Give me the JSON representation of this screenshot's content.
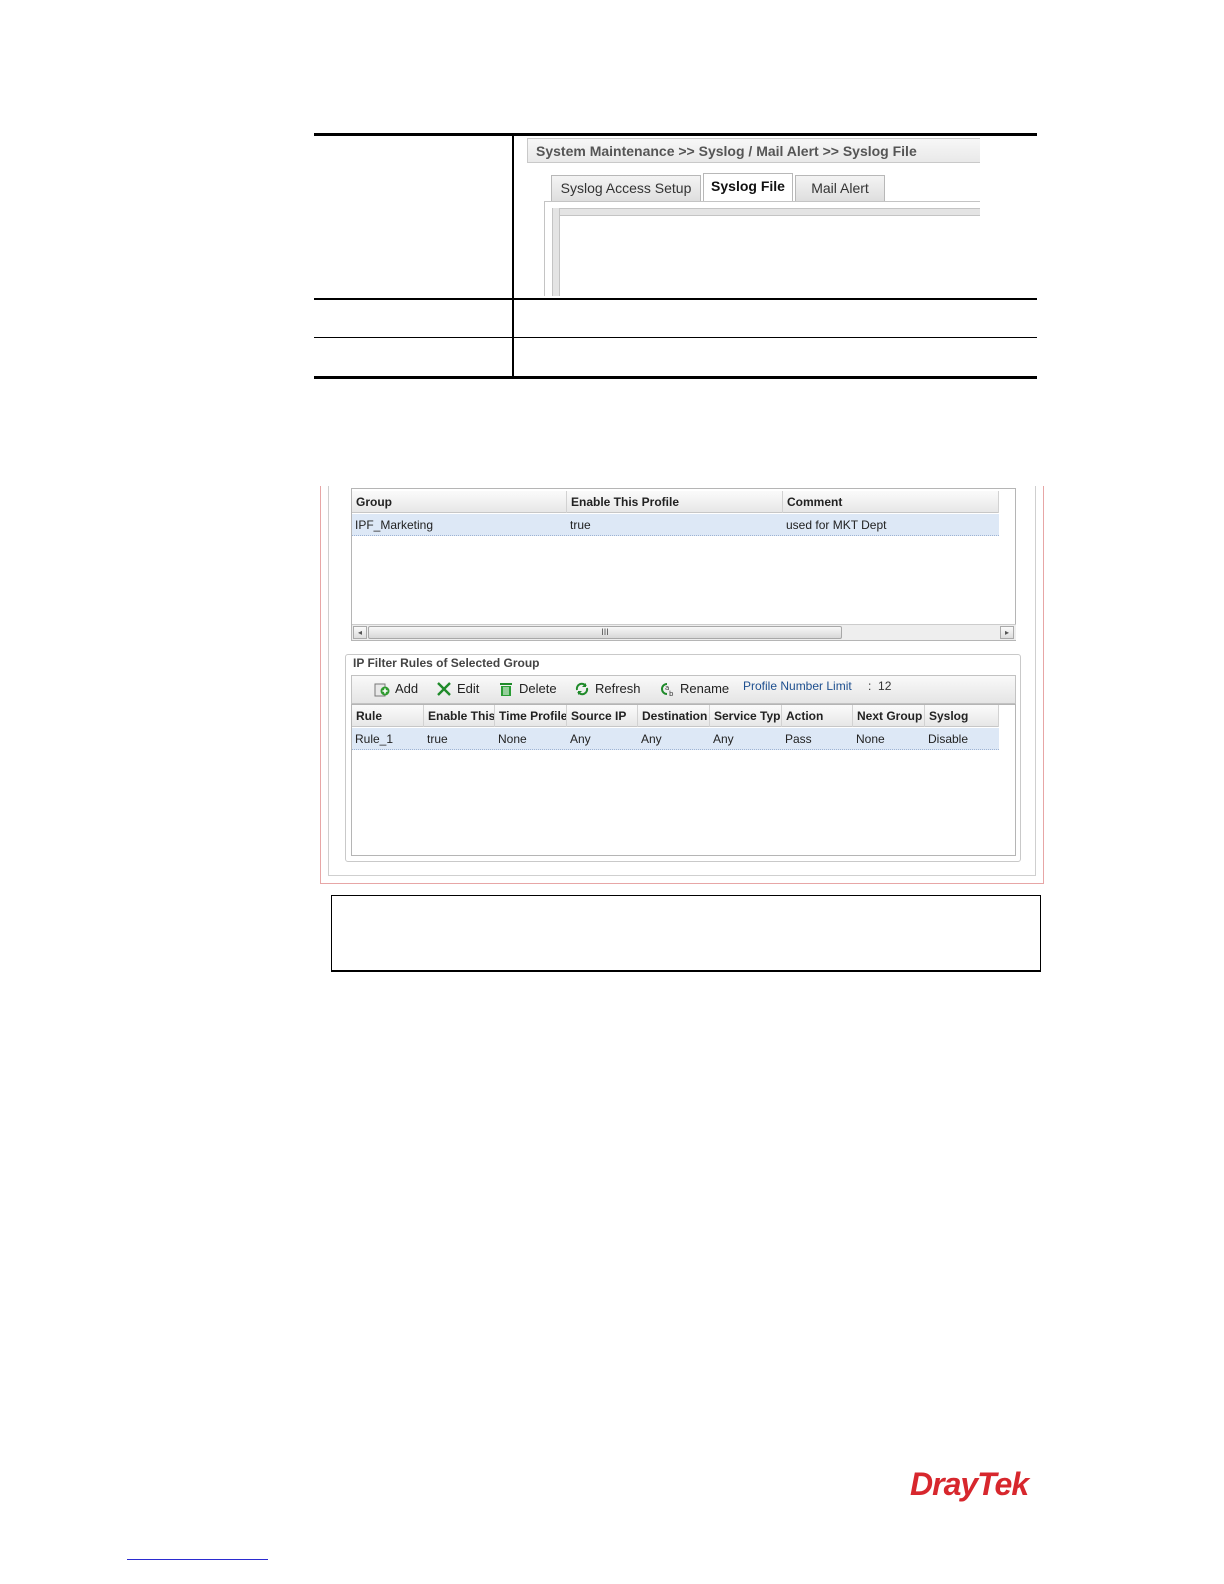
{
  "syslog_screenshot": {
    "breadcrumb": "System Maintenance >> Syslog / Mail Alert >> Syslog File",
    "tabs": [
      {
        "label": "Syslog Access Setup",
        "active": false
      },
      {
        "label": "Syslog File",
        "active": true
      },
      {
        "label": "Mail Alert",
        "active": false
      }
    ]
  },
  "group_grid": {
    "columns": [
      "Group",
      "Enable This Profile",
      "Comment"
    ],
    "rows": [
      {
        "group": "IPF_Marketing",
        "enable": "true",
        "comment": "used for MKT Dept"
      }
    ],
    "scroll_thumb_label": "III"
  },
  "rules_panel": {
    "legend": "IP Filter Rules of Selected Group",
    "toolbar": {
      "add": "Add",
      "edit": "Edit",
      "delete": "Delete",
      "refresh": "Refresh",
      "rename": "Rename"
    },
    "limit_label": "Profile Number Limit",
    "limit_sep": ":",
    "limit_value": "12",
    "columns": [
      "Rule",
      "Enable This",
      "Time Profile",
      "Source IP",
      "Destination I",
      "Service Type",
      "Action",
      "Next Group",
      "Syslog"
    ],
    "rows": [
      {
        "rule": "Rule_1",
        "enable": "true",
        "time_profile": "None",
        "source_ip": "Any",
        "destination_ip": "Any",
        "service_type": "Any",
        "action": "Pass",
        "next_group": "None",
        "syslog": "Disable"
      }
    ]
  },
  "brand": {
    "logo_text": "DrayTek",
    "logo_color": "#d7272d"
  },
  "colors": {
    "selected_row": "#dde8f6",
    "limit_text": "#1d4f8f"
  }
}
